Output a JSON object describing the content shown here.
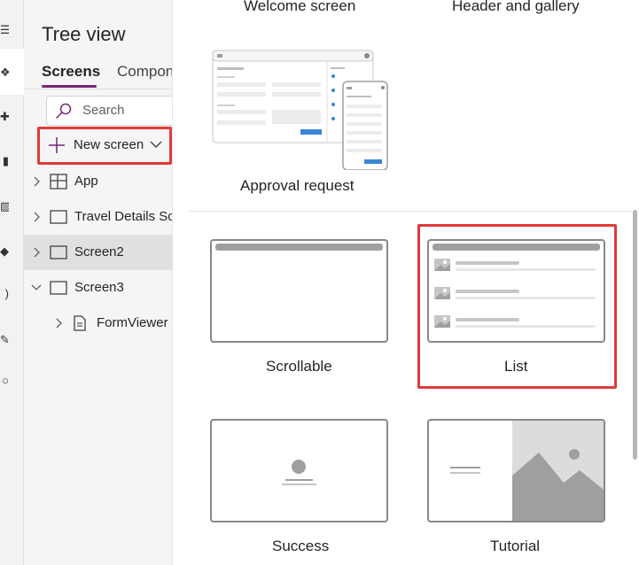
{
  "tree_view": {
    "title": "Tree view",
    "tabs": [
      {
        "label": "Screens",
        "active": true
      },
      {
        "label": "Compon",
        "active": false
      }
    ],
    "search": {
      "placeholder": "Search",
      "value": ""
    },
    "new_screen": {
      "label": "New screen"
    },
    "items": [
      {
        "label": "App",
        "icon": "app-grid-icon",
        "expanded": false,
        "selected": false,
        "level": 0
      },
      {
        "label": "Travel Details Scr",
        "icon": "screen-icon",
        "expanded": false,
        "selected": false,
        "level": 0
      },
      {
        "label": "Screen2",
        "icon": "screen-icon",
        "expanded": false,
        "selected": true,
        "level": 0
      },
      {
        "label": "Screen3",
        "icon": "screen-icon",
        "expanded": true,
        "selected": false,
        "level": 0
      },
      {
        "label": "FormViewer",
        "icon": "form-icon",
        "expanded": false,
        "selected": false,
        "level": 1
      }
    ]
  },
  "gallery": {
    "templates": [
      {
        "label": "Welcome screen"
      },
      {
        "label": "Header and gallery"
      },
      {
        "label": "Approval request"
      },
      {
        "label": "Scrollable"
      },
      {
        "label": "List",
        "highlighted": true
      },
      {
        "label": "Success"
      },
      {
        "label": "Tutorial"
      }
    ]
  },
  "colors": {
    "accent": "#742774",
    "highlight": "#e03a3a",
    "thumb_border": "#8a8886",
    "thumb_fill": "#a19f9d",
    "selected_row": "#e0e0e0"
  }
}
